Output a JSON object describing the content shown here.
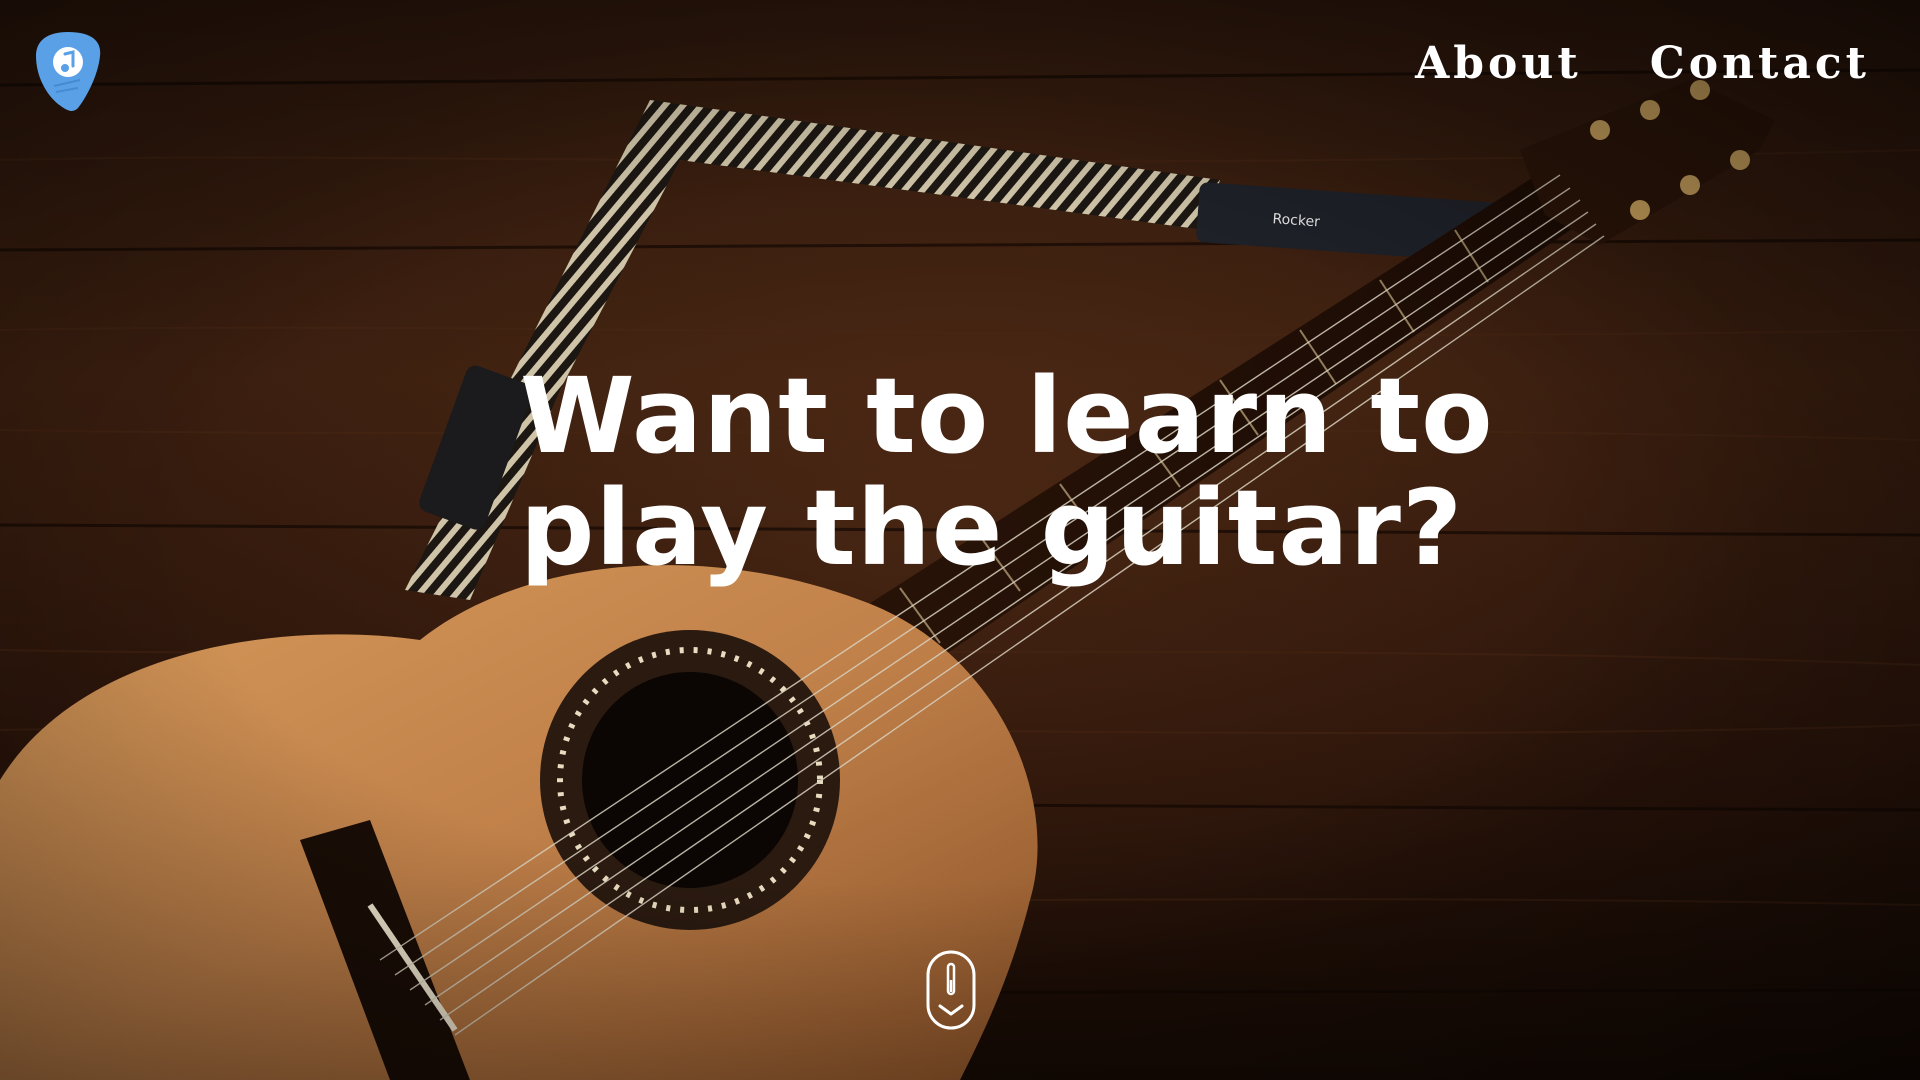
{
  "nav": {
    "items": [
      {
        "label": "About"
      },
      {
        "label": "Contact"
      }
    ]
  },
  "hero": {
    "headline_line1": "Want to learn to",
    "headline_line2": "play the guitar?"
  },
  "icons": {
    "logo": "guitar-pick-music-note-icon",
    "scroll": "mouse-scroll-down-icon"
  },
  "colors": {
    "accent": "#5aa0e6",
    "text": "#ffffff"
  }
}
